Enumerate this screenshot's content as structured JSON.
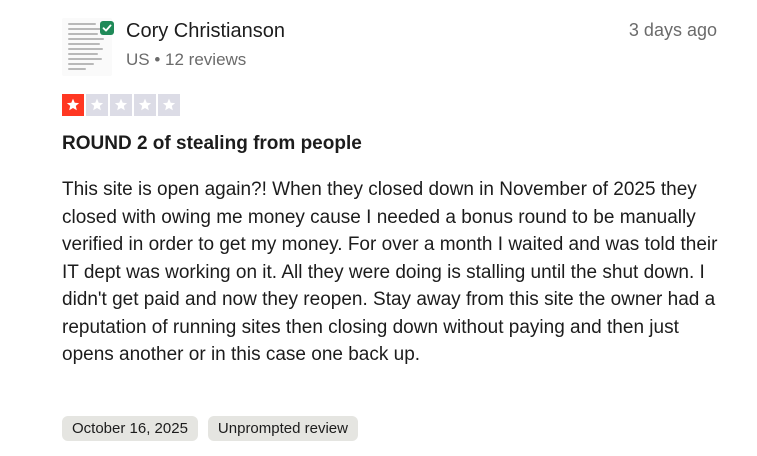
{
  "reviewer": {
    "name": "Cory Christianson",
    "country": "US",
    "separator": "•",
    "review_count": "12 reviews"
  },
  "review": {
    "posted_ago": "3 days ago",
    "rating": 1,
    "rating_max": 5,
    "title": "ROUND 2 of stealing from people",
    "body": "This site is open again?! When they closed down in November of 2025 they closed with owing me money cause I needed a bonus round to be manually verified in order to get my money. For over a month I waited and was told their IT dept was working on it. All they were doing is stalling until the shut down. I didn't get paid and now they reopen. Stay away from this site the owner had a reputation of running sites then closing down without paying and then just opens another or in this case one back up.",
    "date_of_experience": "October 16, 2025",
    "review_type": "Unprompted review"
  },
  "colors": {
    "star_filled": "#ff3722",
    "star_empty": "#dcdce6",
    "verified_badge": "#1f8a58",
    "chip_bg": "#e5e5e1"
  },
  "icons": {
    "avatar": "screenshot-thumbnail-avatar",
    "verified": "checkmark-icon",
    "star": "star-icon"
  }
}
